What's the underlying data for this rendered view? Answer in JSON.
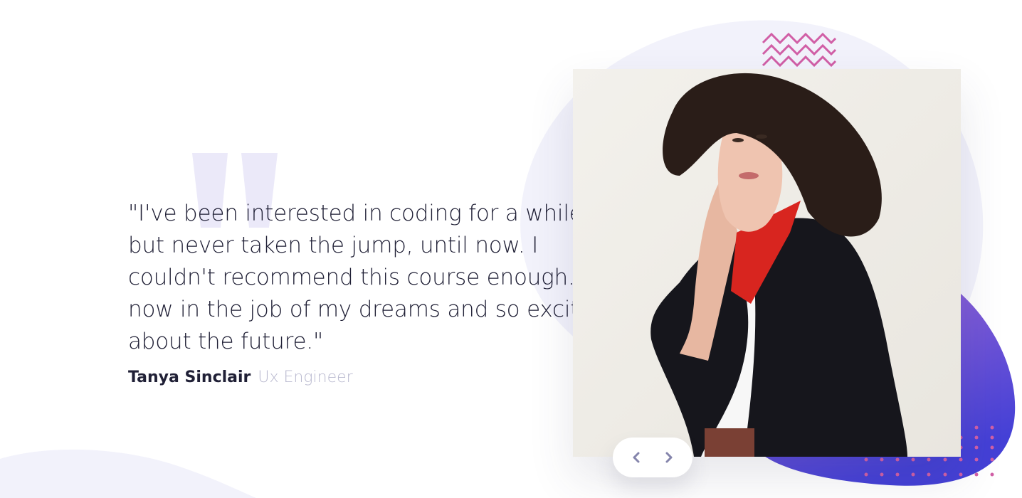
{
  "testimonial": {
    "quote": "\"I've been interested in coding for a while but never taken the jump, until now. I couldn't recommend this course enough. I'm now in the job of my dreams and so excited about the future.\"",
    "author_name": "Tanya Sinclair",
    "author_role": "Ux Engineer"
  },
  "photo": {
    "subject": "portrait of a woman with curly hair, black coat and red scarf"
  },
  "nav": {
    "prev_icon": "chevron-left-icon",
    "next_icon": "chevron-right-icon"
  },
  "colors": {
    "text": "#202036",
    "muted": "#b9b9cf",
    "blob_light": "#f2f2fb",
    "quote_mark": "#ebe9f9",
    "purple_gradient_start": "#9f6ad6",
    "purple_gradient_end": "#3f3fd6",
    "accent_pink": "#d15fa6",
    "nav_icon": "#8585ac"
  }
}
